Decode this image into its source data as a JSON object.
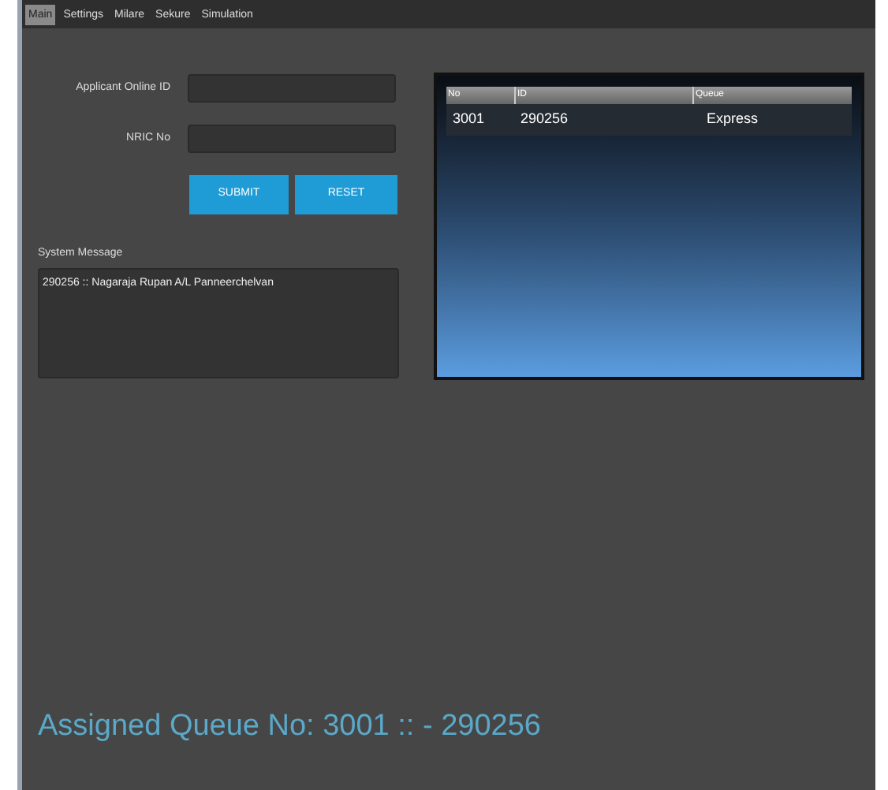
{
  "tabs": [
    {
      "label": "Main",
      "selected": true
    },
    {
      "label": "Settings",
      "selected": false
    },
    {
      "label": "Milare",
      "selected": false
    },
    {
      "label": "Sekure",
      "selected": false
    },
    {
      "label": "Simulation",
      "selected": false
    }
  ],
  "form": {
    "fields": [
      {
        "label": "Applicant Online ID"
      },
      {
        "label": "NRIC No"
      }
    ],
    "buttons": [
      "SUBMIT",
      "RESET"
    ]
  },
  "system_message": {
    "label": "System Message",
    "value": "290256 :: Nagaraja Rupan A/L Panneerchelvan"
  },
  "table": {
    "columns": [
      "No",
      "ID",
      "Queue"
    ],
    "rows": [
      [
        "3001",
        "290256",
        "Express"
      ]
    ]
  },
  "assigned": "Assigned Queue No: 3001 ::  - 290256"
}
